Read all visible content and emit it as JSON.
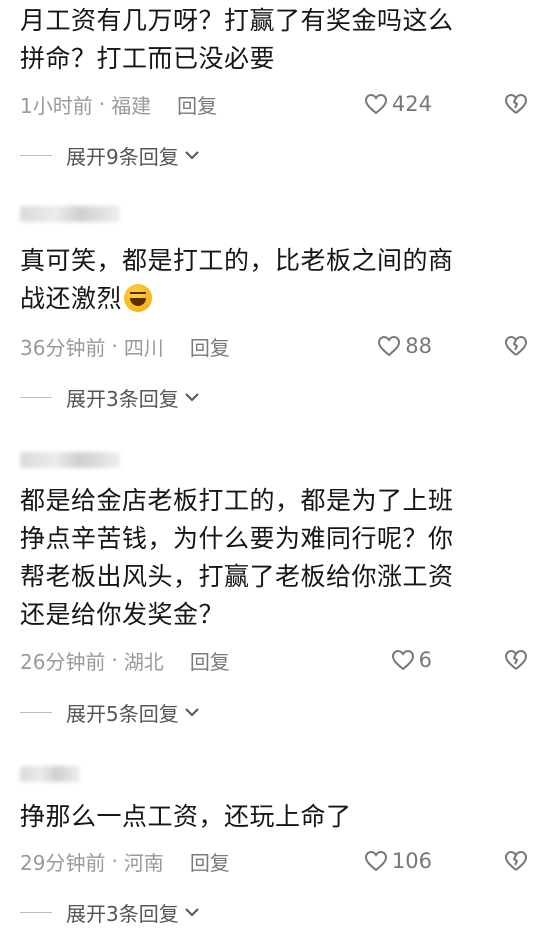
{
  "comments": [
    {
      "text": "月工资有几万呀？打赢了有奖金吗这么\n拼命？打工而已没必要",
      "time": "1小时前",
      "place": "福建",
      "reply": "回复",
      "likes": "424",
      "expand": "展开9条回复"
    },
    {
      "text": "真可笑，都是打工的，比老板之间的商\n战还激烈",
      "emoji": "laughing-emoji",
      "time": "36分钟前",
      "place": "四川",
      "reply": "回复",
      "likes": "88",
      "expand": "展开3条回复"
    },
    {
      "text": "都是给金店老板打工的，都是为了上班\n挣点辛苦钱，为什么要为难同行呢？你\n帮老板出风头，打赢了老板给你涨工资\n还是给你发奖金？",
      "time": "26分钟前",
      "place": "湖北",
      "reply": "回复",
      "likes": "6",
      "expand": "展开5条回复"
    },
    {
      "text": "挣那么一点工资，还玩上命了",
      "time": "29分钟前",
      "place": "河南",
      "reply": "回复",
      "likes": "106",
      "expand": "展开3条回复"
    }
  ],
  "separator": "·",
  "icons": {
    "like": "heart-outline-icon",
    "dislike": "broken-heart-icon",
    "expand": "chevron-down-icon"
  }
}
